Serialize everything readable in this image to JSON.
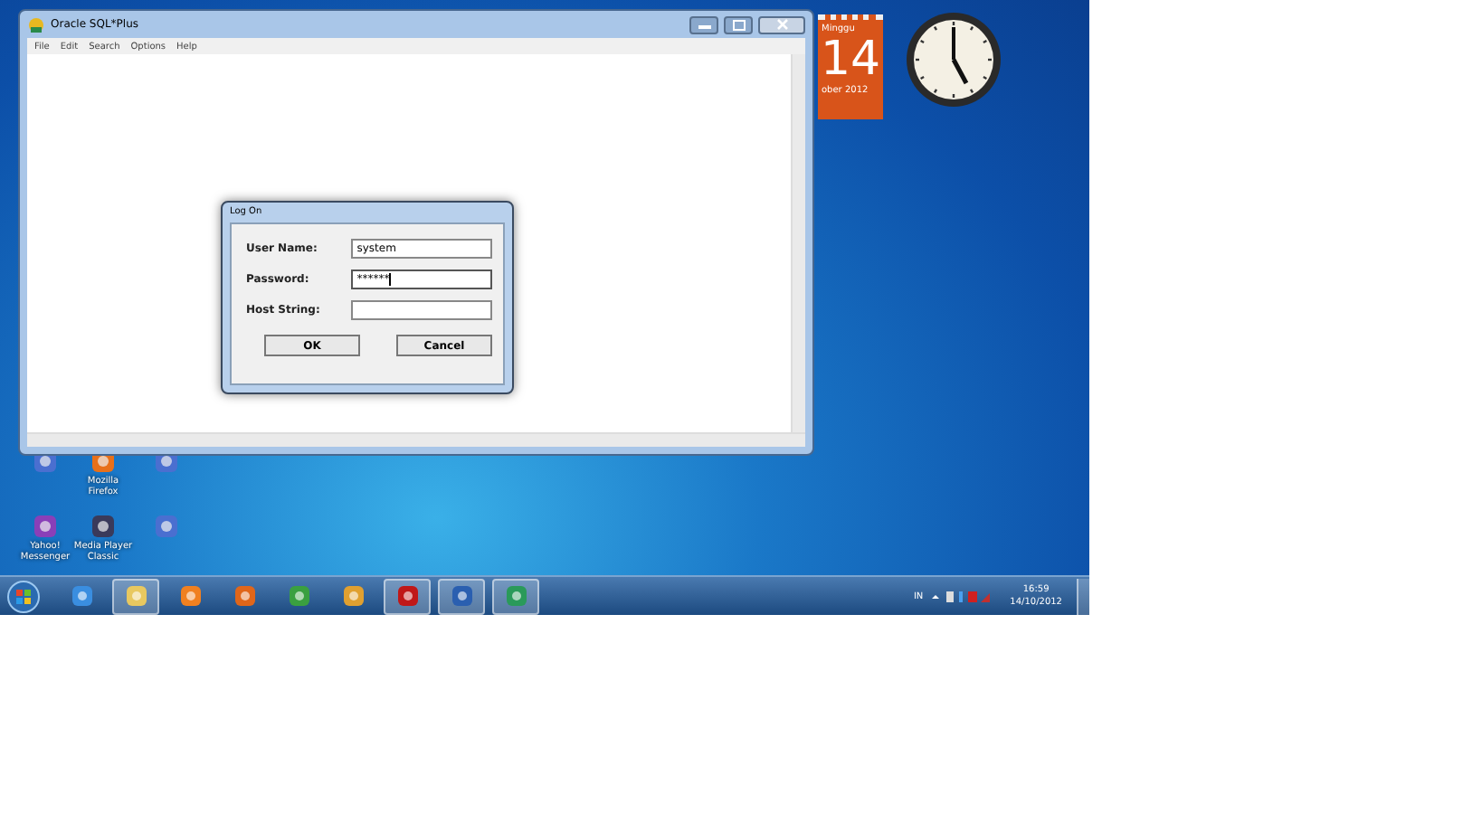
{
  "window": {
    "title": "Oracle SQL*Plus",
    "menu": [
      "File",
      "Edit",
      "Search",
      "Options",
      "Help"
    ]
  },
  "dialog": {
    "title": "Log On",
    "fields": [
      {
        "label": "User Name:",
        "value": "system",
        "focused": false
      },
      {
        "label": "Password:",
        "value": "******",
        "focused": true
      },
      {
        "label": "Host String:",
        "focused": false
      }
    ],
    "buttons": [
      "OK",
      "Cancel"
    ]
  },
  "calendar_gadget": {
    "day_name": "Minggu",
    "day": "14",
    "month_year": "ober 2012"
  },
  "desktop_icons": [
    {
      "kind": "app"
    },
    {
      "kind": "firefox",
      "label": "Mozilla Firefox"
    },
    {
      "kind": "app"
    },
    {
      "kind": "messenger",
      "label": "Yahoo! Messenger"
    },
    {
      "kind": "player",
      "label": "Media Player Classic"
    },
    {
      "kind": "app"
    }
  ],
  "taskbar": {
    "apps": [
      {
        "kind": "ie",
        "running": false
      },
      {
        "kind": "folder",
        "running": true
      },
      {
        "kind": "media",
        "running": false
      },
      {
        "kind": "firefox",
        "running": false
      },
      {
        "kind": "chrome",
        "running": false
      },
      {
        "kind": "winamp",
        "running": false
      },
      {
        "kind": "pdf",
        "running": true
      },
      {
        "kind": "doc",
        "running": true
      },
      {
        "kind": "sqlplus",
        "running": true
      }
    ],
    "language": "IN",
    "time": "16:59",
    "date": "14/10/2012"
  }
}
